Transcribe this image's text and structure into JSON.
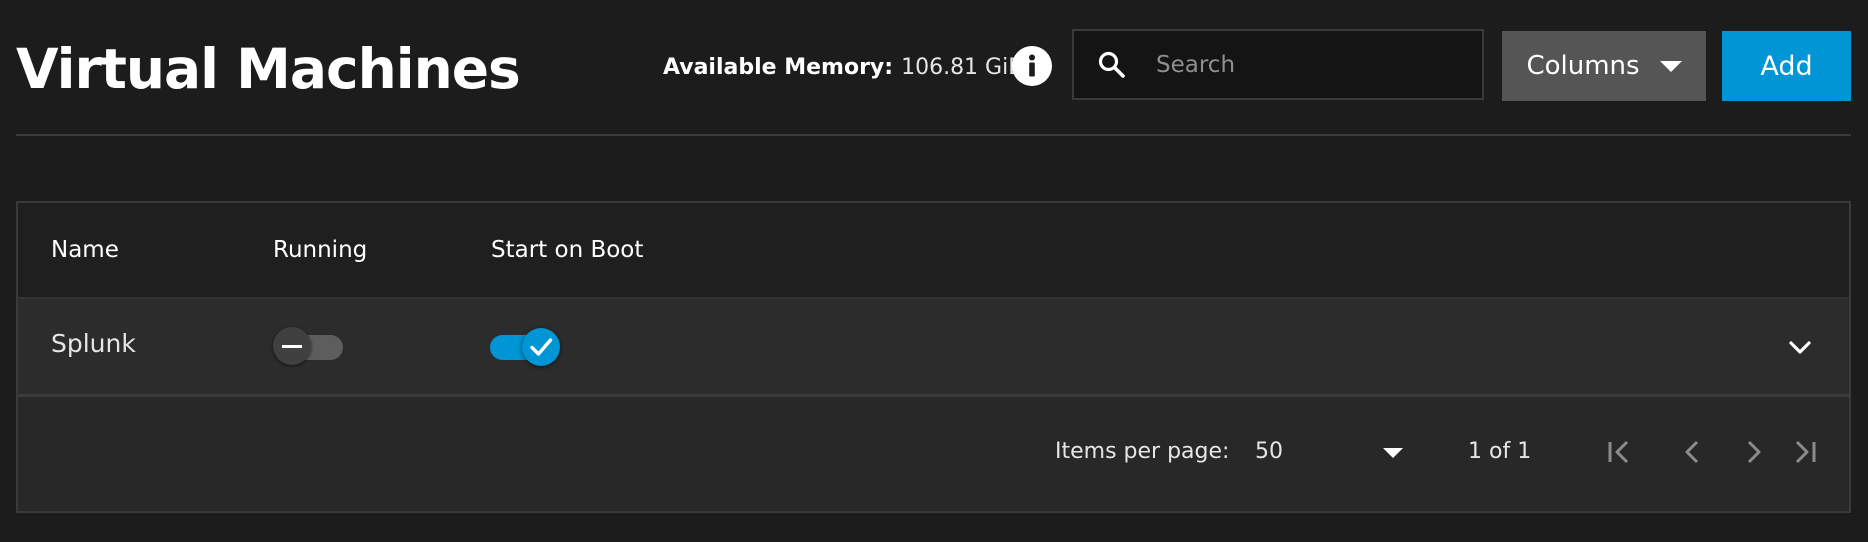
{
  "header": {
    "title": "Virtual Machines",
    "memory_label": "Available Memory:",
    "memory_value": "106.81 GiB",
    "search_placeholder": "Search",
    "search_value": "",
    "columns_label": "Columns",
    "add_label": "Add"
  },
  "icons": {
    "info": "info-icon",
    "search": "search-icon",
    "columns_caret": "caret-down-icon",
    "expand": "chevron-down-icon",
    "first_page": "first-page-icon",
    "prev_page": "chevron-left-icon",
    "next_page": "chevron-right-icon",
    "last_page": "last-page-icon"
  },
  "table": {
    "columns": [
      "Name",
      "Running",
      "Start on Boot"
    ],
    "rows": [
      {
        "name": "Splunk",
        "running": false,
        "start_on_boot": true
      }
    ]
  },
  "paginator": {
    "items_per_page_label": "Items per page:",
    "items_per_page": "50",
    "range": "1 of 1"
  },
  "colors": {
    "background": "#1c1c1c",
    "accent": "#0095d5",
    "columns_button": "#555555",
    "toggle_off_track": "#5d5d5d",
    "divider": "#3a3a3a"
  }
}
